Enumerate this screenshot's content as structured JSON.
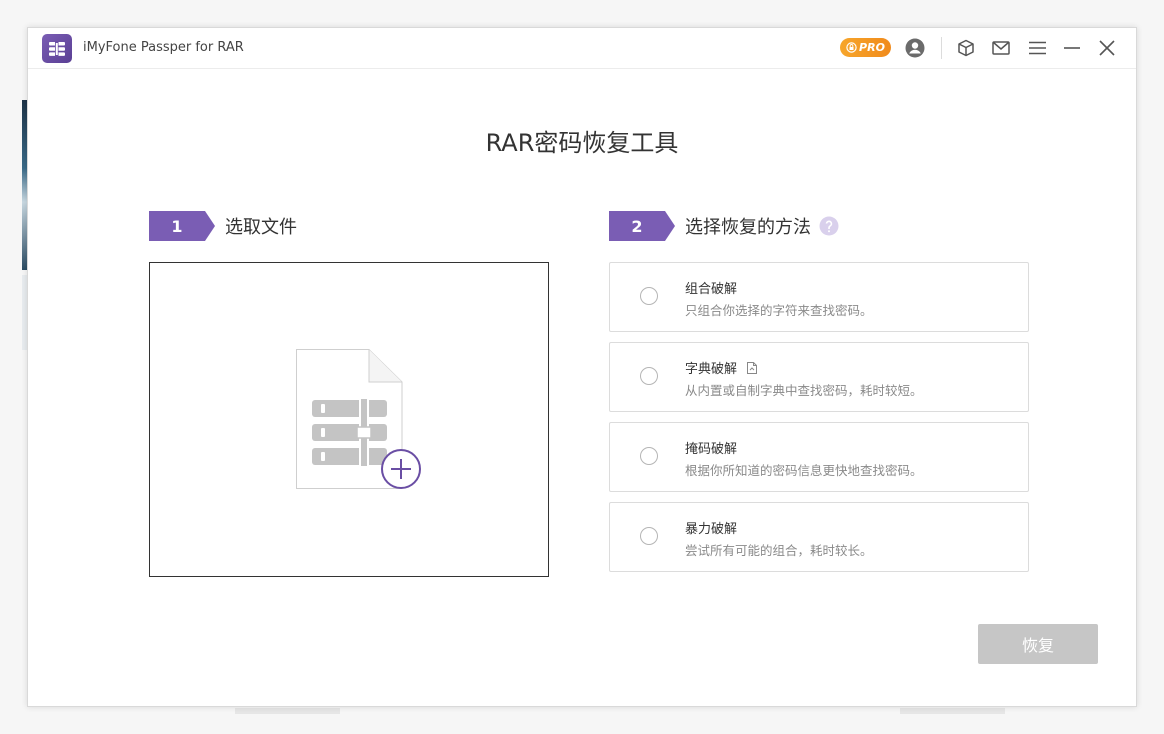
{
  "titlebar": {
    "app_title": "iMyFone Passper for RAR",
    "pro_label": "PRO",
    "icons": [
      "app-logo",
      "pro-badge",
      "user-icon",
      "package-icon",
      "mail-icon",
      "menu-icon",
      "minimize-icon",
      "close-icon"
    ]
  },
  "main": {
    "title": "RAR密码恢复工具",
    "step1": {
      "number": "1",
      "label": "选取文件"
    },
    "step2": {
      "number": "2",
      "label": "选择恢复的方法"
    },
    "methods": [
      {
        "title": "组合破解",
        "desc": "只组合你选择的字符来查找密码。"
      },
      {
        "title": "字典破解",
        "desc": "从内置或自制字典中查找密码，耗时较短。"
      },
      {
        "title": "掩码破解",
        "desc": "根据你所知道的密码信息更快地查找密码。"
      },
      {
        "title": "暴力破解",
        "desc": "尝试所有可能的组合，耗时较长。"
      }
    ],
    "recover_button": "恢复"
  },
  "colors": {
    "accent": "#7a5db4",
    "pro_badge": "#f39a22",
    "disabled_button": "#c6c6c6"
  }
}
